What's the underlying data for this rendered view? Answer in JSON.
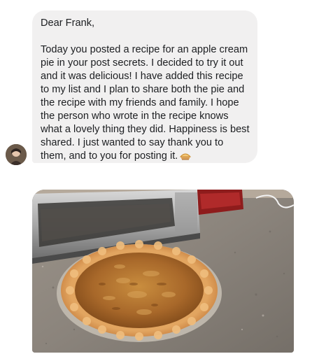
{
  "message": {
    "greeting": "Dear Frank,",
    "lines": [
      "Today you posted a recipe for an apple cream",
      "pie in your post secrets. I decided to try it out",
      "and it was delicious! I have added this recipe",
      "to my list and I plan to share both the pie and",
      "the recipe with my friends and family. I hope",
      "the person who wrote in the recipe knows",
      "what a lovely thing they did. Happiness is best",
      "shared. I just wanted to say thank you to",
      "them, and to you for posting it."
    ],
    "emoji": "pie-emoji"
  },
  "attachment": {
    "kind": "photo",
    "subject": "baked-pie-on-counter"
  },
  "colors": {
    "bubble_bg": "#f1f0f0",
    "text": "#1c1e21"
  }
}
